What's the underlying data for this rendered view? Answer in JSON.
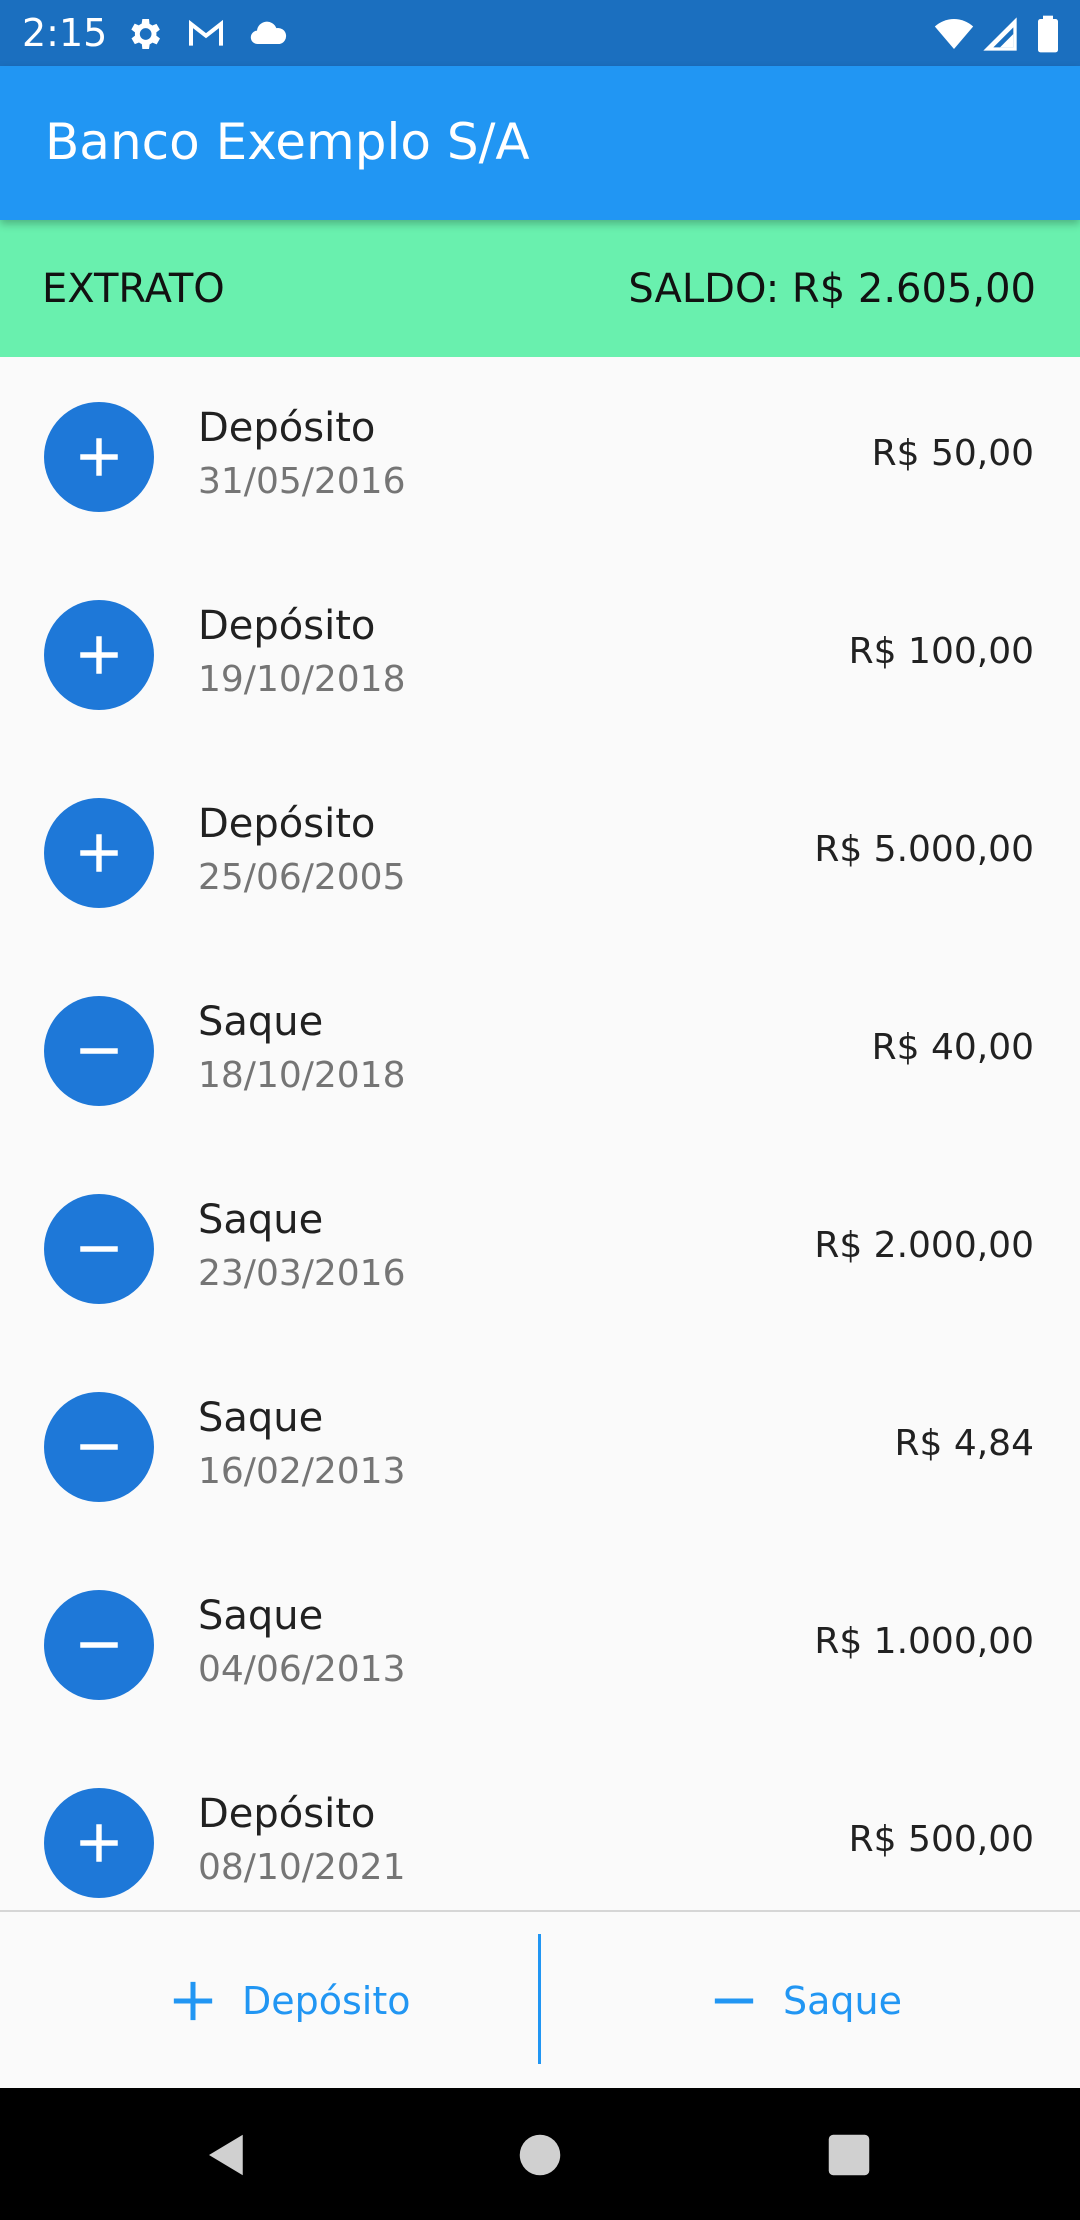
{
  "status_bar": {
    "time": "2:15",
    "icons": [
      "settings-icon",
      "gmail-icon",
      "cloud-icon",
      "wifi-icon",
      "signal-icon",
      "battery-icon"
    ]
  },
  "app_bar": {
    "title": "Banco Exemplo S/A"
  },
  "balance": {
    "label": "EXTRATO",
    "value": "SALDO: R$ 2.605,00"
  },
  "transactions": [
    {
      "type": "deposit",
      "icon": "plus-icon",
      "title": "Depósito",
      "date": "31/05/2016",
      "amount": "R$ 50,00"
    },
    {
      "type": "deposit",
      "icon": "plus-icon",
      "title": "Depósito",
      "date": "19/10/2018",
      "amount": "R$ 100,00"
    },
    {
      "type": "deposit",
      "icon": "plus-icon",
      "title": "Depósito",
      "date": "25/06/2005",
      "amount": "R$ 5.000,00"
    },
    {
      "type": "withdrawal",
      "icon": "minus-icon",
      "title": "Saque",
      "date": "18/10/2018",
      "amount": "R$ 40,00"
    },
    {
      "type": "withdrawal",
      "icon": "minus-icon",
      "title": "Saque",
      "date": "23/03/2016",
      "amount": "R$ 2.000,00"
    },
    {
      "type": "withdrawal",
      "icon": "minus-icon",
      "title": "Saque",
      "date": "16/02/2013",
      "amount": "R$ 4,84"
    },
    {
      "type": "withdrawal",
      "icon": "minus-icon",
      "title": "Saque",
      "date": "04/06/2013",
      "amount": "R$ 1.000,00"
    },
    {
      "type": "deposit",
      "icon": "plus-icon",
      "title": "Depósito",
      "date": "08/10/2021",
      "amount": "R$ 500,00"
    }
  ],
  "actions": {
    "deposit_label": "Depósito",
    "withdraw_label": "Saque"
  },
  "navigation": {
    "icons": [
      "back-icon",
      "home-icon",
      "recents-icon"
    ]
  },
  "colors": {
    "status_bar": "#1b6fbf",
    "app_bar": "#2196f3",
    "balance_bar": "#69f0ae",
    "icon_circle": "#1e78d8",
    "accent": "#2196f3"
  }
}
